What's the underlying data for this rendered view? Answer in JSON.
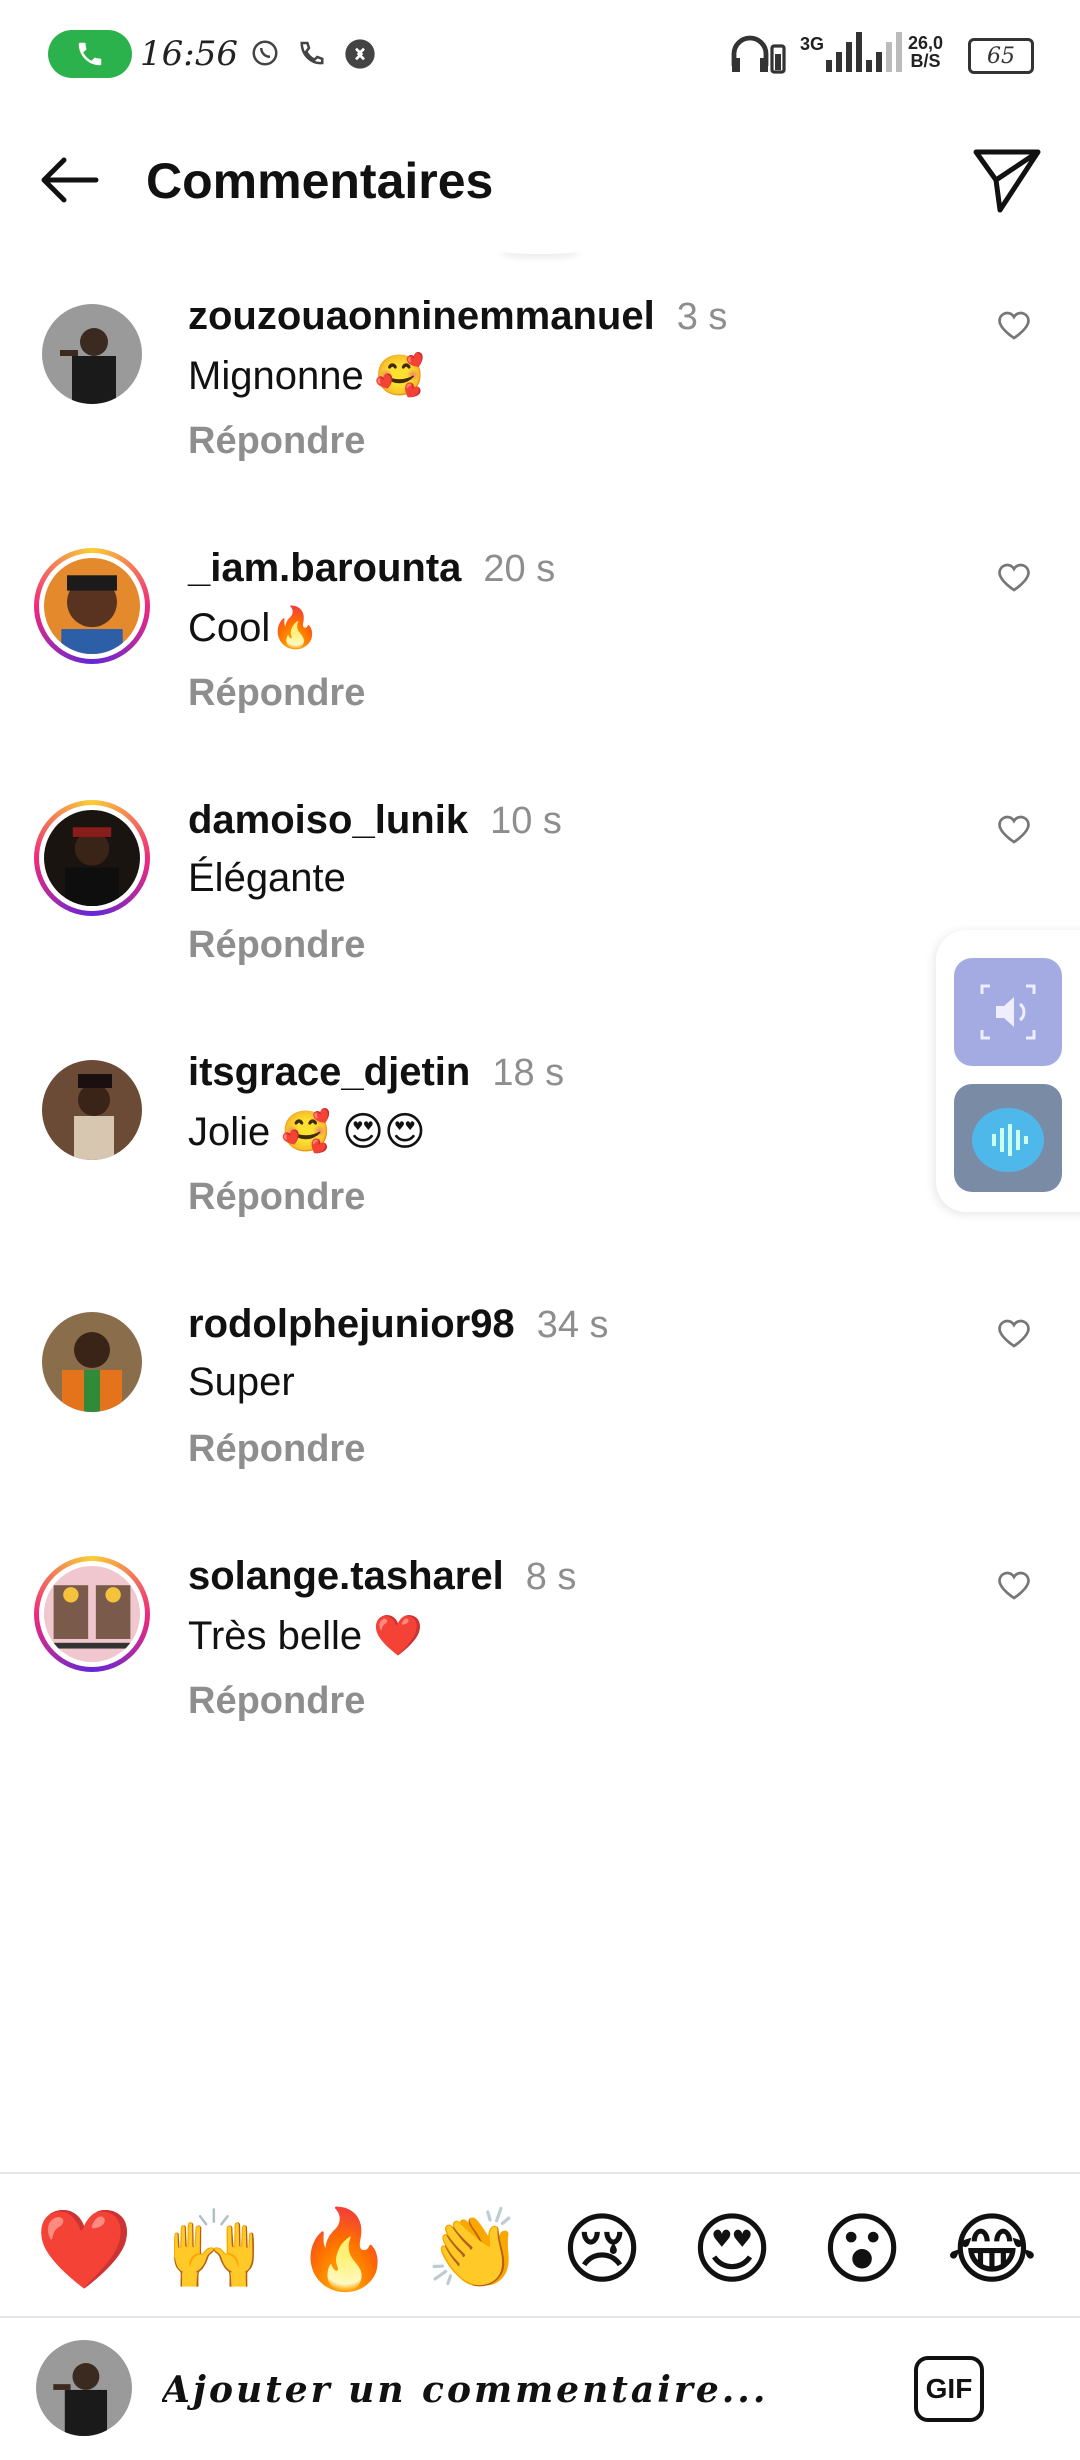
{
  "status_bar": {
    "time": "16:56",
    "network_type": "3G",
    "speed_value": "26,0",
    "speed_unit": "B/S",
    "battery": "65"
  },
  "header": {
    "title": "Commentaires"
  },
  "comments": [
    {
      "username": "zouzouaonninemmanuel",
      "time": "3 s",
      "text": "Mignonne 🥰",
      "reply": "Répondre"
    },
    {
      "username": "_iam.barounta",
      "time": "20 s",
      "text": "Cool🔥",
      "reply": "Répondre"
    },
    {
      "username": "damoiso_lunik",
      "time": "10 s",
      "text": "Élégante",
      "reply": "Répondre"
    },
    {
      "username": "itsgrace_djetin",
      "time": "18 s",
      "text": "Jolie 🥰 😍😍",
      "reply": "Répondre"
    },
    {
      "username": "rodolphejunior98",
      "time": "34 s",
      "text": "Super",
      "reply": "Répondre"
    },
    {
      "username": "solange.tasharel",
      "time": "8 s",
      "text": "Très belle ❤️",
      "reply": "Répondre"
    }
  ],
  "emoji_bar": [
    "❤️",
    "🙌",
    "🔥",
    "👏",
    "😢",
    "😍",
    "😮",
    "😂"
  ],
  "composer": {
    "placeholder": "Ajouter un commentaire...",
    "gif_label": "GIF"
  },
  "colors": {
    "call_green": "#2bb24c",
    "muted_text": "#8e8e8e",
    "story_ring": [
      "#f9ce34",
      "#ee2a7b",
      "#6228d7"
    ],
    "float_button": "#a4abe2"
  }
}
